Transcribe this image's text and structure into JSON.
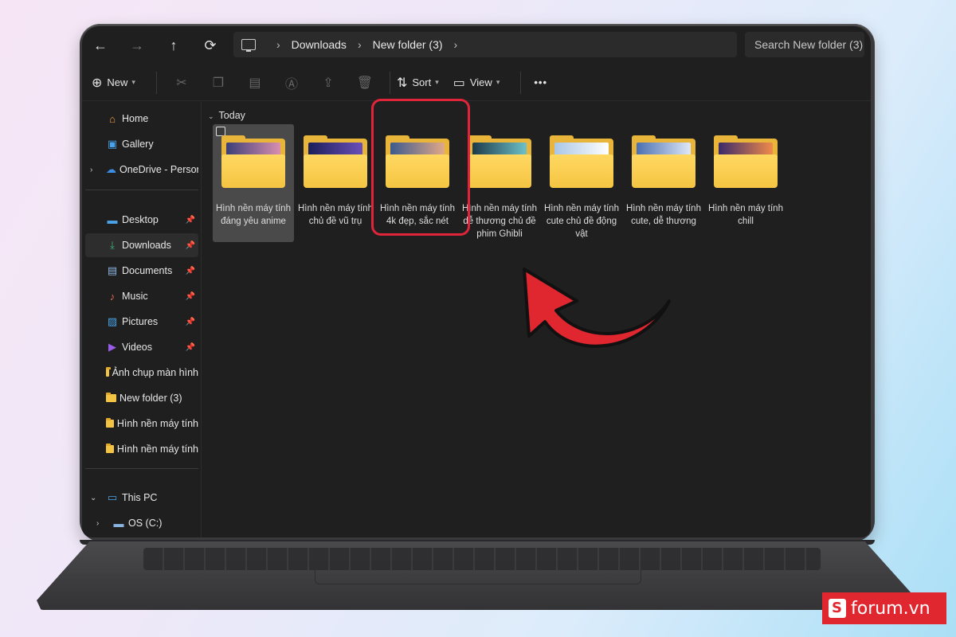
{
  "nav": {
    "back_icon": "←",
    "forward_icon": "→",
    "up_icon": "↑",
    "refresh_icon": "⟳"
  },
  "breadcrumb": {
    "items": [
      "Downloads",
      "New folder (3)"
    ]
  },
  "search": {
    "placeholder": "Search New folder (3)"
  },
  "command_bar": {
    "new_label": "New",
    "sort_label": "Sort",
    "view_label": "View",
    "more_label": "•••"
  },
  "sidebar": {
    "quick": [
      {
        "label": "Home",
        "icon": "home-icon"
      },
      {
        "label": "Gallery",
        "icon": "gallery-icon"
      },
      {
        "label": "OneDrive - Persona",
        "icon": "cloud-icon"
      }
    ],
    "pinned": [
      {
        "label": "Desktop",
        "icon": "desktop-icon"
      },
      {
        "label": "Downloads",
        "icon": "download-icon"
      },
      {
        "label": "Documents",
        "icon": "documents-icon"
      },
      {
        "label": "Music",
        "icon": "music-icon"
      },
      {
        "label": "Pictures",
        "icon": "pictures-icon"
      },
      {
        "label": "Videos",
        "icon": "videos-icon"
      }
    ],
    "folders": [
      "Ảnh chụp màn hình",
      "New folder (3)",
      "Hình nền máy tính",
      "Hình nền máy tính"
    ],
    "this_pc": "This PC",
    "drive": "OS (C:)"
  },
  "content": {
    "group_label": "Today",
    "folders": [
      {
        "name": "Hình nền máy tính đáng yêu anime",
        "colors": [
          "#3b3f78",
          "#d98fb0"
        ]
      },
      {
        "name": "Hình nền máy tính chủ đề vũ trụ",
        "colors": [
          "#1b1f5a",
          "#6b4fb8"
        ]
      },
      {
        "name": "Hình nền máy tính 4k đẹp, sắc nét",
        "colors": [
          "#3d5a8c",
          "#e0a88a"
        ]
      },
      {
        "name": "Hình nền máy tính dễ thương chủ đề phim Ghibli",
        "colors": [
          "#1d3a4a",
          "#6ec1c8"
        ]
      },
      {
        "name": "Hình nền máy tính cute chủ đề động vật",
        "colors": [
          "#a9c6e6",
          "#ffffff"
        ]
      },
      {
        "name": "Hình nền máy tính cute, dễ thương",
        "colors": [
          "#4a6fb0",
          "#dfe8f8"
        ]
      },
      {
        "name": "Hình nền máy tính chill",
        "colors": [
          "#3a2a6a",
          "#f08a4a"
        ]
      }
    ]
  },
  "highlight_color": "#e0253a",
  "watermark": {
    "text": "forum.vn"
  }
}
